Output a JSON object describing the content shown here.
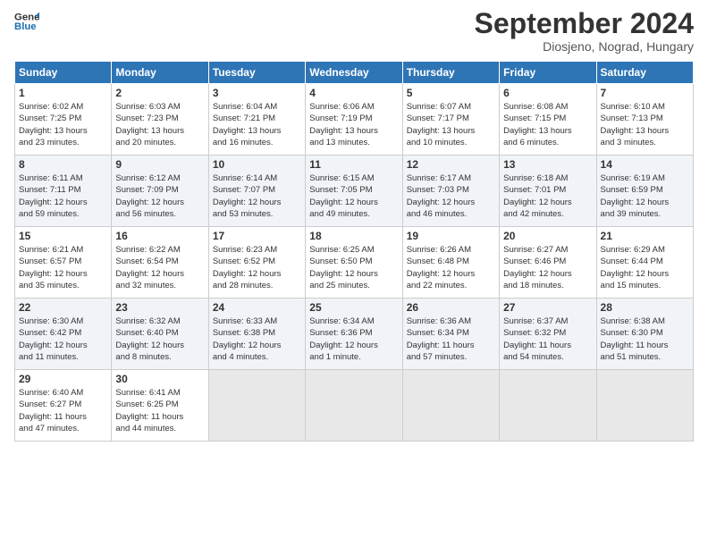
{
  "logo": {
    "line1": "General",
    "line2": "Blue"
  },
  "title": "September 2024",
  "subtitle": "Diosjeno, Nograd, Hungary",
  "days_of_week": [
    "Sunday",
    "Monday",
    "Tuesday",
    "Wednesday",
    "Thursday",
    "Friday",
    "Saturday"
  ],
  "weeks": [
    [
      {
        "day": "1",
        "info": "Sunrise: 6:02 AM\nSunset: 7:25 PM\nDaylight: 13 hours\nand 23 minutes."
      },
      {
        "day": "2",
        "info": "Sunrise: 6:03 AM\nSunset: 7:23 PM\nDaylight: 13 hours\nand 20 minutes."
      },
      {
        "day": "3",
        "info": "Sunrise: 6:04 AM\nSunset: 7:21 PM\nDaylight: 13 hours\nand 16 minutes."
      },
      {
        "day": "4",
        "info": "Sunrise: 6:06 AM\nSunset: 7:19 PM\nDaylight: 13 hours\nand 13 minutes."
      },
      {
        "day": "5",
        "info": "Sunrise: 6:07 AM\nSunset: 7:17 PM\nDaylight: 13 hours\nand 10 minutes."
      },
      {
        "day": "6",
        "info": "Sunrise: 6:08 AM\nSunset: 7:15 PM\nDaylight: 13 hours\nand 6 minutes."
      },
      {
        "day": "7",
        "info": "Sunrise: 6:10 AM\nSunset: 7:13 PM\nDaylight: 13 hours\nand 3 minutes."
      }
    ],
    [
      {
        "day": "8",
        "info": "Sunrise: 6:11 AM\nSunset: 7:11 PM\nDaylight: 12 hours\nand 59 minutes."
      },
      {
        "day": "9",
        "info": "Sunrise: 6:12 AM\nSunset: 7:09 PM\nDaylight: 12 hours\nand 56 minutes."
      },
      {
        "day": "10",
        "info": "Sunrise: 6:14 AM\nSunset: 7:07 PM\nDaylight: 12 hours\nand 53 minutes."
      },
      {
        "day": "11",
        "info": "Sunrise: 6:15 AM\nSunset: 7:05 PM\nDaylight: 12 hours\nand 49 minutes."
      },
      {
        "day": "12",
        "info": "Sunrise: 6:17 AM\nSunset: 7:03 PM\nDaylight: 12 hours\nand 46 minutes."
      },
      {
        "day": "13",
        "info": "Sunrise: 6:18 AM\nSunset: 7:01 PM\nDaylight: 12 hours\nand 42 minutes."
      },
      {
        "day": "14",
        "info": "Sunrise: 6:19 AM\nSunset: 6:59 PM\nDaylight: 12 hours\nand 39 minutes."
      }
    ],
    [
      {
        "day": "15",
        "info": "Sunrise: 6:21 AM\nSunset: 6:57 PM\nDaylight: 12 hours\nand 35 minutes."
      },
      {
        "day": "16",
        "info": "Sunrise: 6:22 AM\nSunset: 6:54 PM\nDaylight: 12 hours\nand 32 minutes."
      },
      {
        "day": "17",
        "info": "Sunrise: 6:23 AM\nSunset: 6:52 PM\nDaylight: 12 hours\nand 28 minutes."
      },
      {
        "day": "18",
        "info": "Sunrise: 6:25 AM\nSunset: 6:50 PM\nDaylight: 12 hours\nand 25 minutes."
      },
      {
        "day": "19",
        "info": "Sunrise: 6:26 AM\nSunset: 6:48 PM\nDaylight: 12 hours\nand 22 minutes."
      },
      {
        "day": "20",
        "info": "Sunrise: 6:27 AM\nSunset: 6:46 PM\nDaylight: 12 hours\nand 18 minutes."
      },
      {
        "day": "21",
        "info": "Sunrise: 6:29 AM\nSunset: 6:44 PM\nDaylight: 12 hours\nand 15 minutes."
      }
    ],
    [
      {
        "day": "22",
        "info": "Sunrise: 6:30 AM\nSunset: 6:42 PM\nDaylight: 12 hours\nand 11 minutes."
      },
      {
        "day": "23",
        "info": "Sunrise: 6:32 AM\nSunset: 6:40 PM\nDaylight: 12 hours\nand 8 minutes."
      },
      {
        "day": "24",
        "info": "Sunrise: 6:33 AM\nSunset: 6:38 PM\nDaylight: 12 hours\nand 4 minutes."
      },
      {
        "day": "25",
        "info": "Sunrise: 6:34 AM\nSunset: 6:36 PM\nDaylight: 12 hours\nand 1 minute."
      },
      {
        "day": "26",
        "info": "Sunrise: 6:36 AM\nSunset: 6:34 PM\nDaylight: 11 hours\nand 57 minutes."
      },
      {
        "day": "27",
        "info": "Sunrise: 6:37 AM\nSunset: 6:32 PM\nDaylight: 11 hours\nand 54 minutes."
      },
      {
        "day": "28",
        "info": "Sunrise: 6:38 AM\nSunset: 6:30 PM\nDaylight: 11 hours\nand 51 minutes."
      }
    ],
    [
      {
        "day": "29",
        "info": "Sunrise: 6:40 AM\nSunset: 6:27 PM\nDaylight: 11 hours\nand 47 minutes."
      },
      {
        "day": "30",
        "info": "Sunrise: 6:41 AM\nSunset: 6:25 PM\nDaylight: 11 hours\nand 44 minutes."
      },
      {
        "day": "",
        "info": ""
      },
      {
        "day": "",
        "info": ""
      },
      {
        "day": "",
        "info": ""
      },
      {
        "day": "",
        "info": ""
      },
      {
        "day": "",
        "info": ""
      }
    ]
  ]
}
